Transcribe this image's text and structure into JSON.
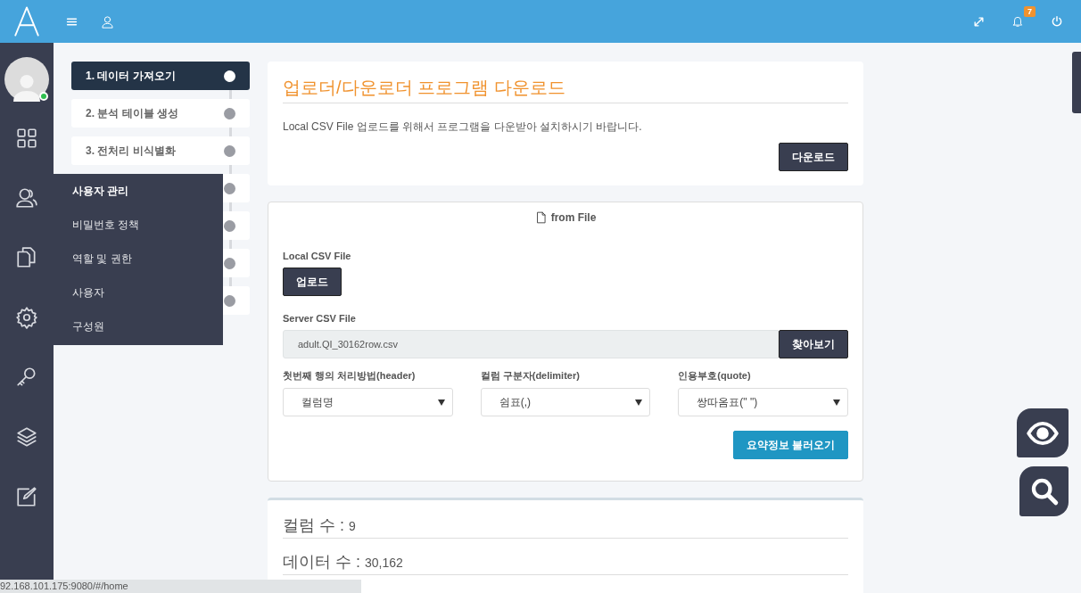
{
  "header": {
    "notification_count": "7"
  },
  "steps": [
    {
      "label": "1. 데이터 가져오기",
      "selected": true
    },
    {
      "label": "2. 분석 테이블 생성",
      "selected": false
    },
    {
      "label": "3. 전처리 비식별화",
      "selected": false
    },
    {
      "selected": false
    },
    {
      "selected": false
    },
    {
      "selected": false
    },
    {
      "selected": false
    }
  ],
  "flyout_menu": [
    {
      "label": "사용자 관리",
      "kind": "heading"
    },
    {
      "label": "비밀번호 정책",
      "kind": "link"
    },
    {
      "label": "역할 및 권한",
      "kind": "link"
    },
    {
      "label": "사용자",
      "kind": "link"
    },
    {
      "label": "구성원",
      "kind": "link"
    }
  ],
  "download_card": {
    "title": "업로더/다운로더 프로그램 다운로드",
    "description": "Local CSV File 업로드를 위해서 프로그램을 다운받아 설치하시기 바랍니다.",
    "button": "다운로드"
  },
  "file_card": {
    "title": "from File",
    "local_label": "Local CSV File",
    "upload_button": "업로드",
    "server_label": "Server CSV File",
    "server_value": "adult.QI_30162row.csv",
    "browse_button": "찾아보기",
    "selects": [
      {
        "label": "첫번째 행의 처리방법(header)",
        "value": "컬럼명"
      },
      {
        "label": "컬럼 구분자(delimiter)",
        "value": "쉼표(,)"
      },
      {
        "label": "인용부호(quote)",
        "value": "쌍따옴표(\" \")"
      }
    ],
    "summary_button": "요약정보 불러오기"
  },
  "stats": [
    {
      "label": "컬럼 수 : ",
      "value": "9"
    },
    {
      "label": "데이터 수 : ",
      "value": "30,162"
    }
  ],
  "status_bar": "92.168.101.175:9080/#/home"
}
